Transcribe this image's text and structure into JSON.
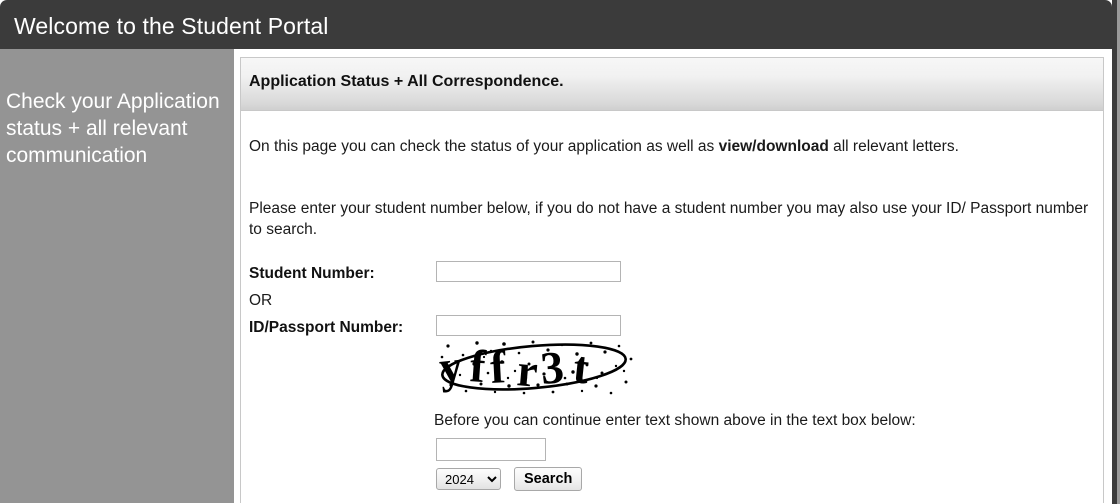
{
  "window": {
    "title": "Welcome to the Student Portal"
  },
  "sidebar": {
    "heading": "Check your Application status + all relevant communication",
    "background_color": "#949494",
    "text_color": "#ffffff"
  },
  "panel": {
    "header_title": "Application Status + All Correspondence.",
    "intro_before": "On this page you can check the status of your application as well as ",
    "intro_emphasis": "view/download",
    "intro_after": " all relevant letters.",
    "instructions": "Please enter your student number below, if you do not have a student number you may also use  your  ID/ Passport number to search."
  },
  "form": {
    "student_number_label": "Student Number:",
    "student_number_value": "",
    "student_number_placeholder": "",
    "or_label": "OR",
    "id_passport_label": "ID/Passport Number:",
    "id_passport_value": "",
    "id_passport_placeholder": "",
    "captcha_text": "yffr3t",
    "captcha_alt": "captcha-image",
    "captcha_note": "Before you can continue enter text shown above in the text box below:",
    "captcha_input_value": "",
    "captcha_input_placeholder": "",
    "year_selected": "2024",
    "year_options": [
      "2024"
    ],
    "search_label": "Search"
  },
  "colors": {
    "topbar": "#3b3b3b",
    "sidebar": "#949494",
    "panel_border": "#c8c8c8",
    "panel_header_top": "#f7f7f7",
    "panel_header_bottom": "#cfcfcf",
    "body_text": "#1a1a1a"
  }
}
